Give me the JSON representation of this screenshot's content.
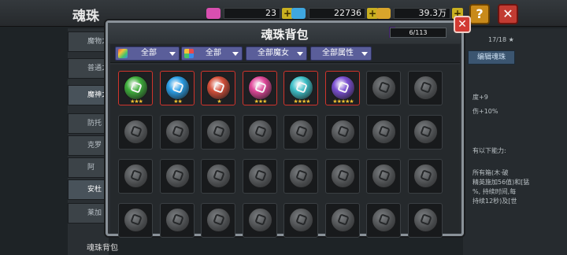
{
  "background": {
    "title": "魂珠",
    "resources": [
      {
        "name": "pink-gem",
        "value": "23",
        "color": "#d94fb0"
      },
      {
        "name": "blue-gem",
        "value": "22736",
        "color": "#3fa7e0"
      },
      {
        "name": "gold-chest",
        "value": "39.3万",
        "color": "#d9a52b"
      }
    ],
    "sidebar_tabs": [
      {
        "label": "魔物之"
      },
      {
        "label": "普通之"
      },
      {
        "label": "魔神之"
      },
      {
        "label": "防托"
      },
      {
        "label": "克罗"
      },
      {
        "label": "阿"
      },
      {
        "label": "安杜"
      },
      {
        "label": "莱加"
      }
    ],
    "sidebar_bottom": "魂珠背包",
    "right_panel": {
      "count": "17/18 ★",
      "button": "编辑魂珠",
      "lines": [
        "度+9",
        "伤+10%",
        "有以下能力:",
        "所有箱(木·破",
        "精英施加56值)和[猛",
        "%, 持续时间,每",
        "持续12秒)及[世"
      ]
    }
  },
  "modal": {
    "title": "魂珠背包",
    "capacity": "6/113",
    "close_label": "✕",
    "filters": [
      {
        "label": "全部",
        "icon": "rainbow-icon"
      },
      {
        "label": "全部",
        "icon": "palette-icon"
      },
      {
        "label": "全部魔女",
        "icon": ""
      },
      {
        "label": "全部属性",
        "icon": ""
      }
    ],
    "owned_orbs": [
      {
        "name": "green-orb",
        "stars": "★★★",
        "color": "#3fae3c"
      },
      {
        "name": "blue-orb",
        "stars": "★★",
        "color": "#2b9ee6"
      },
      {
        "name": "red-orb",
        "stars": "★",
        "color": "#d4503a"
      },
      {
        "name": "pink-orb",
        "stars": "★★★",
        "color": "#e0489a"
      },
      {
        "name": "teal-orb",
        "stars": "★★★★",
        "color": "#3ec0c8"
      },
      {
        "name": "purple-orb",
        "stars": "★★★★★",
        "color": "#7a4fd1"
      }
    ],
    "grid_rows": 4,
    "grid_cols": 8
  }
}
